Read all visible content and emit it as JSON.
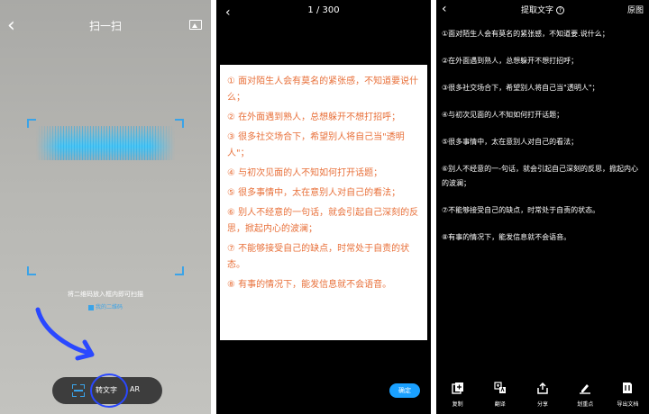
{
  "scanner": {
    "title": "扫一扫",
    "hint": "将二维码放入框内即可扫描",
    "my_code": "我的二维码",
    "modes": {
      "text": "转文字",
      "ar": "AR"
    }
  },
  "preview": {
    "counter": "1 / 300",
    "paragraphs": [
      "① 面对陌生人会有莫名的紧张感，不知道要说什么；",
      "② 在外面遇到熟人，总想躲开不想打招呼；",
      "③ 很多社交场合下，希望别人将自己当\"透明人\"；",
      "④ 与初次见面的人不知如何打开话题；",
      "⑤ 很多事情中，太在意别人对自己的看法；",
      "⑥ 别人不经意的一句话，就会引起自己深刻的反思，掀起内心的波澜；",
      "⑦ 不能够接受自己的缺点，时常处于自责的状态。",
      "⑧ 有事的情况下，能发信息就不会语音。"
    ],
    "confirm": "确定"
  },
  "extract": {
    "title": "提取文字",
    "original": "原图",
    "lines": [
      "①面对陌生人会有莫名的紧张感，不知道要.说什么；",
      "②在外面遇到熟人，总想躲开不想打招呼；",
      "③很多社交场合下，希望别人将自己当\"透明人\"；",
      "④与初次见面的人不知如何打开话题；",
      "⑤很多事情中，太在意别人对自己的看法；",
      "⑥别人不经意的一-句话，就会引起自己深刻的反思，掀起内心的波澜；",
      "⑦不能够接受自己的缺点，时常处于自责的状态。",
      "⑧有事的情况下，能发信息就不会语音。"
    ],
    "toolbar": [
      "复制",
      "翻译",
      "分享",
      "划重点",
      "导出文档"
    ]
  },
  "colors": {
    "accent": "#1aa0ff",
    "doc_text": "#e8703a",
    "highlight_circle": "#2a48ff"
  }
}
